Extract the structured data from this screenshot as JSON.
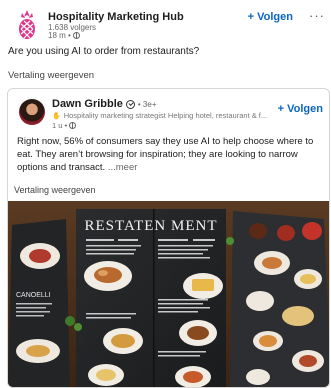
{
  "post": {
    "author": "Hospitality Marketing Hub",
    "followers": "1.638 volgers",
    "time": "18 m •",
    "follow_label": "+ Volgen",
    "more_label": "···",
    "text": "Are you using AI to order from restaurants?",
    "translate_label": "Vertaling weergeven"
  },
  "shared": {
    "author": "Dawn Gribble",
    "degree": "• 3e+",
    "headline": "Hospitality marketing strategist Helping hotel, restaurant & f...",
    "time": "1 u •",
    "follow_label": "+ Volgen",
    "text": "Right now, 56% of consumers say they use AI to help choose where to eat. They aren’t browsing for inspiration; they are looking to narrow options and transact.",
    "more_label": "...meer",
    "translate_label": "Vertaling weergeven"
  },
  "image": {
    "menu_title": "RESTATEN MENT",
    "left_panel_text": "CANOELLI"
  },
  "colors": {
    "link_blue": "#0a66c2",
    "logo_pink": "#e0338c"
  }
}
